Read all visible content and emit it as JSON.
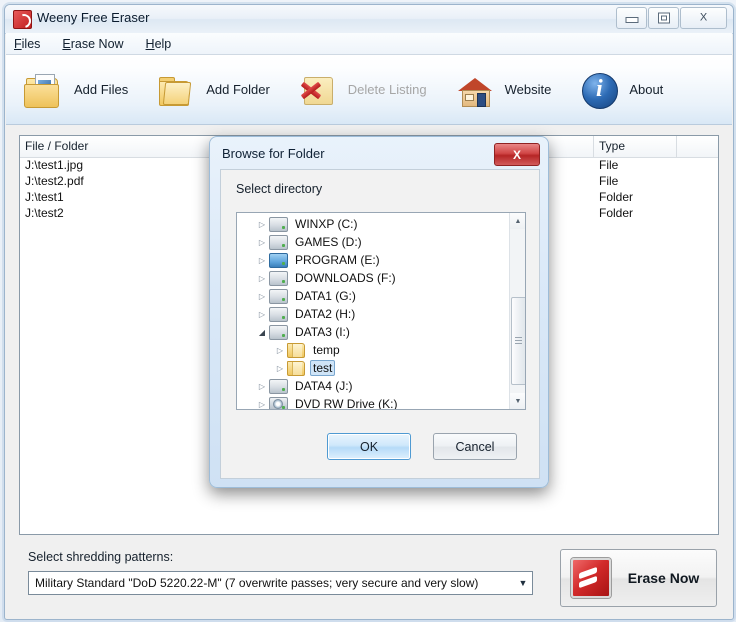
{
  "window": {
    "title": "Weeny Free Eraser",
    "icon": "eraser-icon",
    "controls": {
      "minimize": "minimize",
      "maximize": "maximize",
      "close": "X"
    }
  },
  "menu": {
    "items": [
      {
        "label": "Files",
        "accel": "F"
      },
      {
        "label": "Erase Now",
        "accel": "E"
      },
      {
        "label": "Help",
        "accel": "H"
      }
    ]
  },
  "toolbar": {
    "buttons": [
      {
        "label": "Add Files",
        "icon": "add-files-icon",
        "disabled": false
      },
      {
        "label": "Add Folder",
        "icon": "add-folder-icon",
        "disabled": false
      },
      {
        "label": "Delete Listing",
        "icon": "delete-listing-icon",
        "disabled": true
      },
      {
        "label": "Website",
        "icon": "house-icon",
        "disabled": false
      },
      {
        "label": "About",
        "icon": "info-icon",
        "disabled": false
      }
    ]
  },
  "list": {
    "columns": [
      "File / Folder",
      "Type",
      ""
    ],
    "rows": [
      {
        "path": "J:\\test1.jpg",
        "type": "File"
      },
      {
        "path": "J:\\test2.pdf",
        "type": "File"
      },
      {
        "path": "J:\\test1",
        "type": "Folder"
      },
      {
        "path": "J:\\test2",
        "type": "Folder"
      }
    ]
  },
  "bottom": {
    "shred_label": "Select shredding patterns:",
    "pattern_value": "Military Standard \"DoD 5220.22-M\" (7 overwrite passes; very secure and very slow)",
    "dropdown_arrow": "▼",
    "erase_button": "Erase Now",
    "erase_icon": "erase-icon"
  },
  "dialog": {
    "title": "Browse for Folder",
    "close_label": "X",
    "sublabel": "Select directory",
    "tree": [
      {
        "label": "WINXP (C:)",
        "icon": "drive-icon",
        "expanded": false,
        "indent": 0,
        "selected": false
      },
      {
        "label": "GAMES (D:)",
        "icon": "drive-icon",
        "expanded": false,
        "indent": 0,
        "selected": false
      },
      {
        "label": "PROGRAM (E:)",
        "icon": "program-drive-icon",
        "expanded": false,
        "indent": 0,
        "selected": false
      },
      {
        "label": "DOWNLOADS (F:)",
        "icon": "drive-icon",
        "expanded": false,
        "indent": 0,
        "selected": false
      },
      {
        "label": "DATA1 (G:)",
        "icon": "drive-icon",
        "expanded": false,
        "indent": 0,
        "selected": false
      },
      {
        "label": "DATA2 (H:)",
        "icon": "drive-icon",
        "expanded": false,
        "indent": 0,
        "selected": false
      },
      {
        "label": "DATA3 (I:)",
        "icon": "drive-icon",
        "expanded": true,
        "indent": 0,
        "selected": false
      },
      {
        "label": "temp",
        "icon": "folder-icon",
        "expanded": false,
        "indent": 1,
        "selected": false
      },
      {
        "label": "test",
        "icon": "folder-icon",
        "expanded": false,
        "indent": 1,
        "selected": true
      },
      {
        "label": "DATA4 (J:)",
        "icon": "drive-icon",
        "expanded": false,
        "indent": 0,
        "selected": false
      },
      {
        "label": "DVD RW Drive (K:)",
        "icon": "dvd-drive-icon",
        "expanded": false,
        "indent": 0,
        "selected": false
      }
    ],
    "collapsed_glyph": "▷",
    "expanded_glyph": "◢",
    "scroll_up": "▲",
    "scroll_down": "▼",
    "ok_label": "OK",
    "cancel_label": "Cancel"
  },
  "colors": {
    "accent_blue": "#4f9ad2",
    "title_red": "#c01f1f",
    "dialog_close_red": "#b52525",
    "selection_blue": "#cfe4f7"
  }
}
